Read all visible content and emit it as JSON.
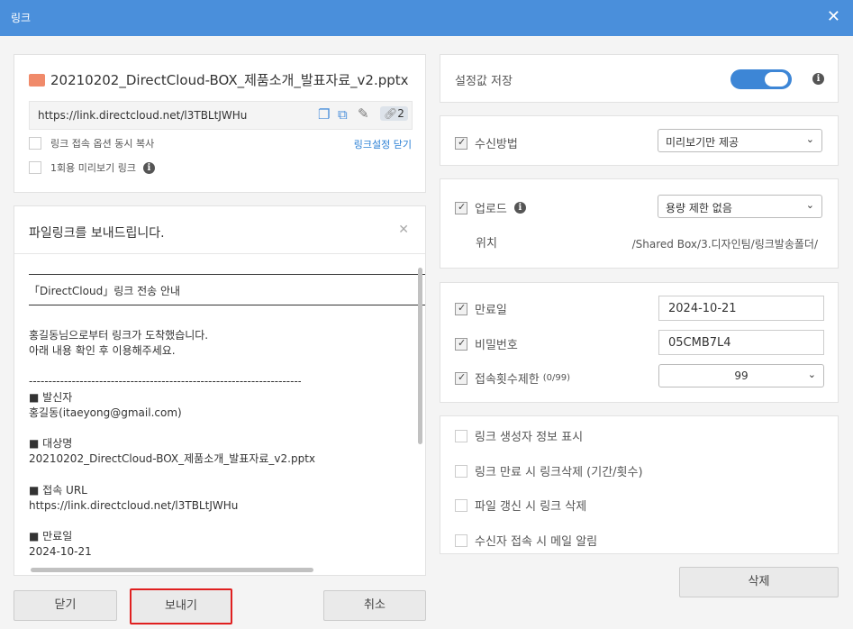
{
  "title": "링크",
  "file": {
    "name": "20210202_DirectCloud-BOX_제품소개_발표자료_v2.pptx",
    "url": "https://link.directcloud.net/l3TBLtJWHu",
    "link_count": "2"
  },
  "options": {
    "copy_with_options": "링크 접속 옵션 동시 복사",
    "close_settings": "링크설정 닫기",
    "one_time_preview": "1회용 미리보기 링크"
  },
  "message": {
    "subject": "파일링크를 보내드립니다.",
    "heading": "「DirectCloud」링크 전송 안내",
    "intro1": "홍길동님으로부터 링크가 도착했습니다.",
    "intro2": "아래 내용 확인 후 이용해주세요.",
    "divider": "--------------------------------------------------------------------------------",
    "sender_label": "■ 발신자",
    "sender": "홍길동(itaeyong@gmail.com)",
    "target_label": "■ 대상명",
    "target": "20210202_DirectCloud-BOX_제품소개_발표자료_v2.pptx",
    "url_label": "■ 접속 URL",
    "url": "https://link.directcloud.net/l3TBLtJWHu",
    "expiry_label": "■ 만료일",
    "expiry": "2024-10-21"
  },
  "buttons": {
    "close": "닫기",
    "send": "보내기",
    "cancel": "취소",
    "delete": "삭제"
  },
  "settings": {
    "save_label": "설정값 저장",
    "save_on": true,
    "receive_label": "수신방법",
    "receive_value": "미리보기만 제공",
    "upload_label": "업로드",
    "upload_value": "용량 제한 없음",
    "location_label": "위치",
    "location": "/Shared Box/3.디자인팀/링크발송폴더/",
    "expiry_label": "만료일",
    "expiry": "2024-10-21",
    "password_label": "비밀번호",
    "password": "05CMB7L4",
    "access_label": "접속횟수제한",
    "access_count": "(0/99)",
    "access_value": "99",
    "extra": [
      "링크 생성자 정보 표시",
      "링크 만료 시 링크삭제 (기간/횟수)",
      "파일 갱신 시 링크 삭제",
      "수신자 접속 시 메일 알림"
    ]
  },
  "colors": {
    "header": "#4a8fdb",
    "send_highlight": "#e02020"
  }
}
